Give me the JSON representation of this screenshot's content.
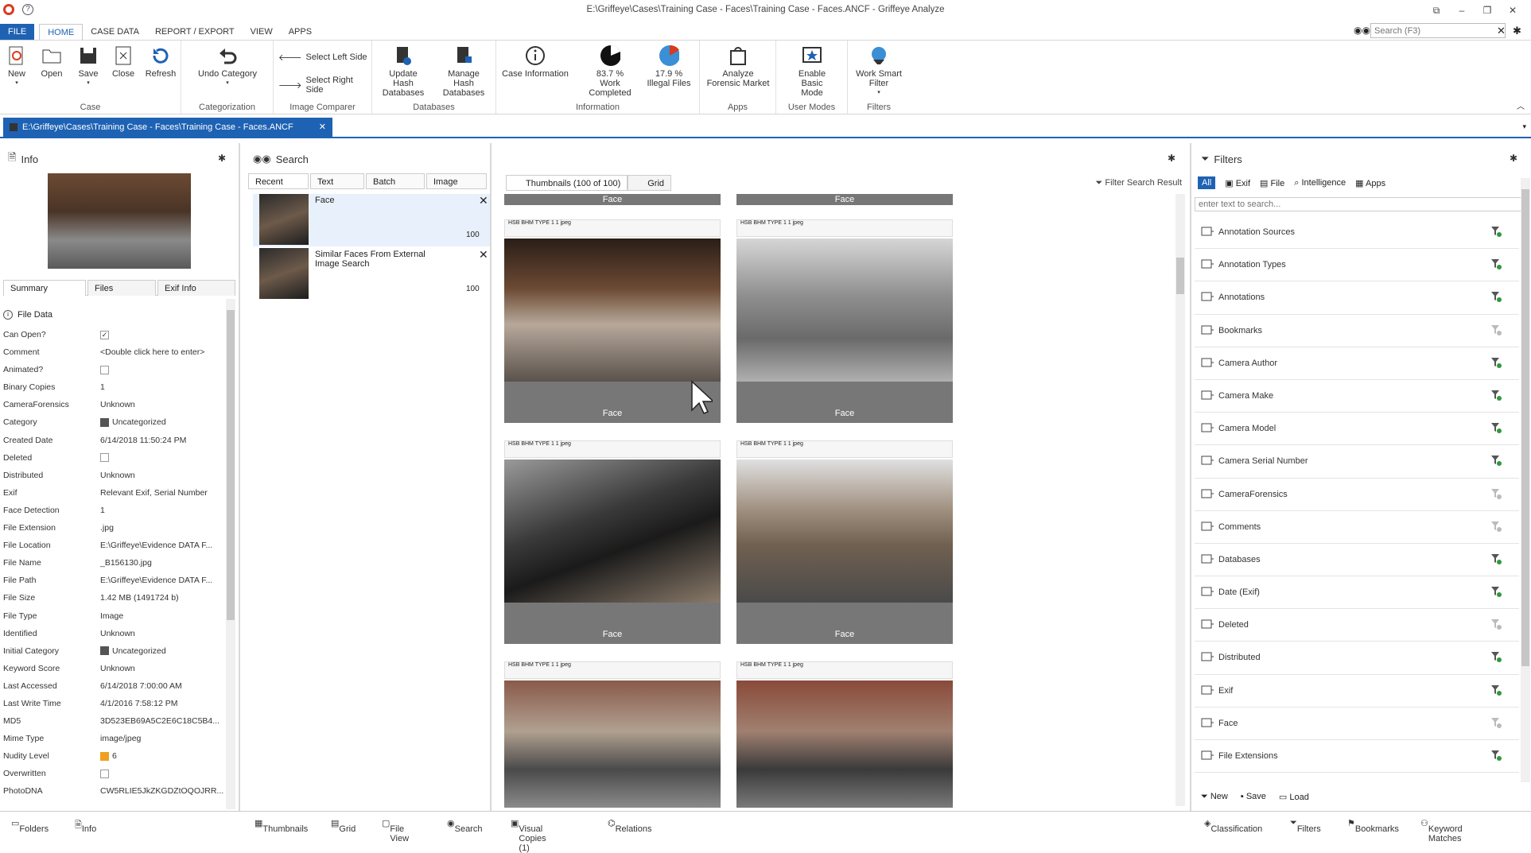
{
  "window": {
    "title": "E:\\Griffeye\\Cases\\Training Case - Faces\\Training Case - Faces.ANCF - Griffeye Analyze",
    "search_placeholder": "Search (F3)"
  },
  "menu": {
    "file": "FILE",
    "home": "HOME",
    "case_data": "CASE DATA",
    "report": "REPORT / EXPORT",
    "view": "VIEW",
    "apps": "APPS"
  },
  "ribbon": {
    "case": {
      "label": "Case",
      "new": "New",
      "open": "Open",
      "save": "Save",
      "close": "Close",
      "refresh": "Refresh"
    },
    "categorization": {
      "label": "Categorization",
      "undo": "Undo Category"
    },
    "comparer": {
      "label": "Image Comparer",
      "left": "Select Left Side",
      "right": "Select Right Side"
    },
    "databases": {
      "label": "Databases",
      "update": "Update Hash Databases",
      "manage": "Manage Hash Databases"
    },
    "information": {
      "label": "Information",
      "case_info": "Case Information",
      "work": "83.7 % Work Completed",
      "illegal": "17.9 % Illegal Files"
    },
    "apps": {
      "label": "Apps",
      "analyze": "Analyze Forensic Market"
    },
    "modes": {
      "label": "User Modes",
      "basic": "Enable Basic Mode"
    },
    "filters": {
      "label": "Filters",
      "smart": "Work Smart Filter"
    }
  },
  "doc_tab": "E:\\Griffeye\\Cases\\Training Case - Faces\\Training Case - Faces.ANCF",
  "info": {
    "title": "Info",
    "tabs": [
      "Summary",
      "Files",
      "Exif Info"
    ],
    "section": "File Data",
    "props": [
      {
        "k": "Can Open?",
        "v": "",
        "type": "check",
        "checked": true
      },
      {
        "k": "Comment",
        "v": "<Double click here to enter>"
      },
      {
        "k": "Animated?",
        "v": "",
        "type": "check",
        "checked": false
      },
      {
        "k": "Binary Copies",
        "v": "1"
      },
      {
        "k": "CameraForensics",
        "v": "Unknown"
      },
      {
        "k": "Category",
        "v": "Uncategorized",
        "type": "swatch",
        "color": "#555555"
      },
      {
        "k": "Created Date",
        "v": "6/14/2018 11:50:24 PM"
      },
      {
        "k": "Deleted",
        "v": "",
        "type": "check",
        "checked": false
      },
      {
        "k": "Distributed",
        "v": "Unknown"
      },
      {
        "k": "Exif",
        "v": "Relevant Exif, Serial Number"
      },
      {
        "k": "Face Detection",
        "v": "1"
      },
      {
        "k": "File Extension",
        "v": ".jpg"
      },
      {
        "k": "File Location",
        "v": "E:\\Griffeye\\Evidence DATA F..."
      },
      {
        "k": "File Name",
        "v": "_B156130.jpg"
      },
      {
        "k": "File Path",
        "v": "E:\\Griffeye\\Evidence DATA F..."
      },
      {
        "k": "File Size",
        "v": "1.42 MB   (1491724 b)"
      },
      {
        "k": "File Type",
        "v": "Image"
      },
      {
        "k": "Identified",
        "v": "Unknown"
      },
      {
        "k": "Initial Category",
        "v": "Uncategorized",
        "type": "swatch",
        "color": "#555555"
      },
      {
        "k": "Keyword Score",
        "v": "Unknown"
      },
      {
        "k": "Last Accessed",
        "v": "6/14/2018 7:00:00 AM"
      },
      {
        "k": "Last Write Time",
        "v": "4/1/2016 7:58:12 PM"
      },
      {
        "k": "MD5",
        "v": "3D523EB69A5C2E6C18C5B4..."
      },
      {
        "k": "Mime Type",
        "v": "image/jpeg"
      },
      {
        "k": "Nudity Level",
        "v": "6",
        "type": "swatch",
        "color": "#f0a020"
      },
      {
        "k": "Overwritten",
        "v": "",
        "type": "check",
        "checked": false
      },
      {
        "k": "PhotoDNA",
        "v": "CW5RLIE5JkZKGDZtOQOJRR..."
      }
    ]
  },
  "search": {
    "title": "Search",
    "tabs": [
      "Recent",
      "Text",
      "Batch",
      "Image"
    ],
    "items": [
      {
        "label": "Face",
        "count": "100"
      },
      {
        "label": "Similar Faces From External Image Search",
        "count": "100"
      }
    ]
  },
  "thumbs": {
    "tabs": [
      "Thumbnails (100 of 100)",
      "Grid"
    ],
    "filter_result": "Filter Search Result",
    "face": "Face",
    "strip": "HSB BHM TYPE 1 1 jpeg"
  },
  "filters": {
    "title": "Filters",
    "tabs": [
      "All",
      "Exif",
      "File",
      "Intelligence",
      "Apps"
    ],
    "placeholder": "enter text to search...",
    "items": [
      "Annotation Sources",
      "Annotation Types",
      "Annotations",
      "Bookmarks",
      "Camera Author",
      "Camera Make",
      "Camera Model",
      "Camera Serial Number",
      "CameraForensics",
      "Comments",
      "Databases",
      "Date (Exif)",
      "Deleted",
      "Distributed",
      "Exif",
      "Face",
      "File Extensions"
    ],
    "bottom": [
      "New",
      "Save",
      "Load"
    ]
  },
  "status": {
    "left": [
      "Folders",
      "Info"
    ],
    "mid": [
      "Thumbnails",
      "Grid",
      "File View",
      "Search",
      "Visual Copies (1)",
      "Relations"
    ],
    "right": [
      "Classification",
      "Filters",
      "Bookmarks",
      "Keyword Matches"
    ]
  }
}
